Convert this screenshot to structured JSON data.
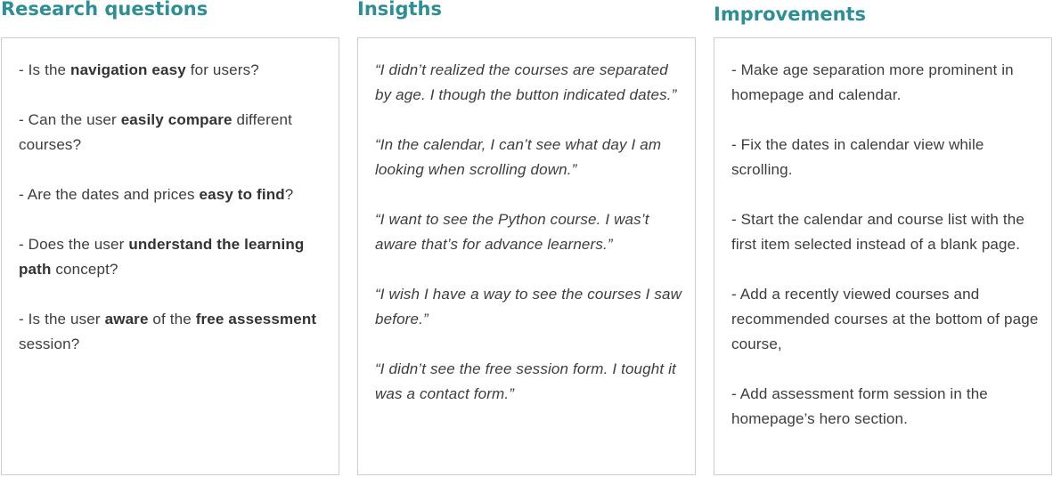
{
  "columns": [
    {
      "title": "Research questions",
      "items": [
        {
          "parts": [
            {
              "t": "- Is the "
            },
            {
              "t": "navigation easy",
              "b": true
            },
            {
              "t": " for users?"
            }
          ]
        },
        {
          "parts": [
            {
              "t": "- Can the user "
            },
            {
              "t": "easily compare",
              "b": true
            },
            {
              "t": " different courses?"
            }
          ]
        },
        {
          "parts": [
            {
              "t": "- Are the dates and prices "
            },
            {
              "t": "easy to find",
              "b": true
            },
            {
              "t": "?"
            }
          ]
        },
        {
          "parts": [
            {
              "t": "- Does the user "
            },
            {
              "t": "understand the learning path",
              "b": true
            },
            {
              "t": " concept?"
            }
          ]
        },
        {
          "parts": [
            {
              "t": "- Is the user "
            },
            {
              "t": "aware",
              "b": true
            },
            {
              "t": " of the "
            },
            {
              "t": "free assessment",
              "b": true
            },
            {
              "t": " session?"
            }
          ]
        }
      ]
    },
    {
      "title": "Insigths",
      "items": [
        {
          "parts": [
            {
              "t": "“I didn’t realized the courses are separated by age. I though the button indicated dates.”"
            }
          ]
        },
        {
          "parts": [
            {
              "t": "“In the calendar, I can’t see what day I am looking when scrolling down.”"
            }
          ]
        },
        {
          "parts": [
            {
              "t": "“I want to see the Python course. I was’t aware that’s for advance learners.”"
            }
          ]
        },
        {
          "parts": [
            {
              "t": "“I wish I have a way to see the courses I saw before.”"
            }
          ]
        },
        {
          "parts": [
            {
              "t": "“I didn’t see the free session form. I tought it was a contact form.”"
            }
          ]
        }
      ]
    },
    {
      "title": "Improvements",
      "items": [
        {
          "parts": [
            {
              "t": "- Make age separation more prominent in homepage and calendar."
            }
          ]
        },
        {
          "parts": [
            {
              "t": "- Fix the dates in calendar view while scrolling."
            }
          ]
        },
        {
          "parts": [
            {
              "t": "- Start the calendar and course list with the first item selected instead of a blank page."
            }
          ]
        },
        {
          "parts": [
            {
              "t": "- Add a recently viewed courses and recommended courses at the bottom of page course,"
            }
          ]
        },
        {
          "parts": [
            {
              "t": "- Add assessment form session in the homepage’s hero section."
            }
          ]
        }
      ]
    }
  ]
}
